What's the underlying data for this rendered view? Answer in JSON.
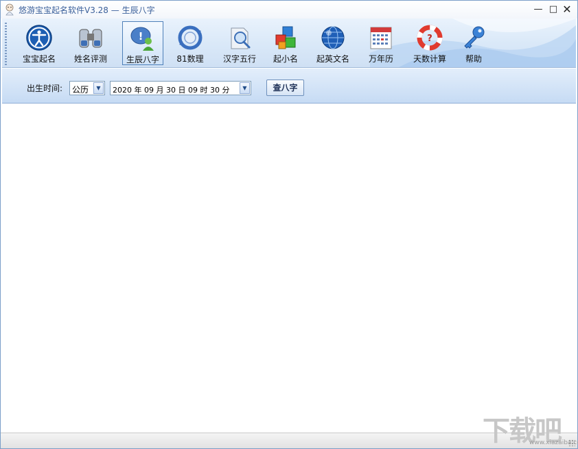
{
  "window": {
    "title": "悠游宝宝起名软件V3.28",
    "separator": "—",
    "subtitle": "生辰八字",
    "minimize_glyph": "—",
    "maximize_glyph": "□",
    "close_glyph": "✕"
  },
  "toolbar": {
    "items": [
      {
        "label": "宝宝起名",
        "icon": "accessibility-icon"
      },
      {
        "label": "姓名评测",
        "icon": "binoculars-icon"
      },
      {
        "label": "生辰八字",
        "icon": "user-info-icon",
        "active": true
      },
      {
        "label": "81数理",
        "icon": "cycle-icon"
      },
      {
        "label": "汉字五行",
        "icon": "search-doc-icon"
      },
      {
        "label": "起小名",
        "icon": "blocks-icon"
      },
      {
        "label": "起英文名",
        "icon": "globe-icon"
      },
      {
        "label": "万年历",
        "icon": "calendar-icon"
      },
      {
        "label": "天数计算",
        "icon": "lifebuoy-icon"
      },
      {
        "label": "帮助",
        "icon": "key-icon"
      }
    ]
  },
  "birth_time": {
    "label": "出生时间:",
    "calendar_type": "公历",
    "datetime_value": "2020 年 09 月 30 日   09 时 30 分",
    "query_button": "查八字"
  },
  "watermark": {
    "text": "下载吧",
    "url": "www.xiazaiba.com"
  },
  "colors": {
    "title_text": "#3a5f9a",
    "toolbar_bg": "#d9e8f8",
    "accent_border": "#4d7fb8"
  }
}
